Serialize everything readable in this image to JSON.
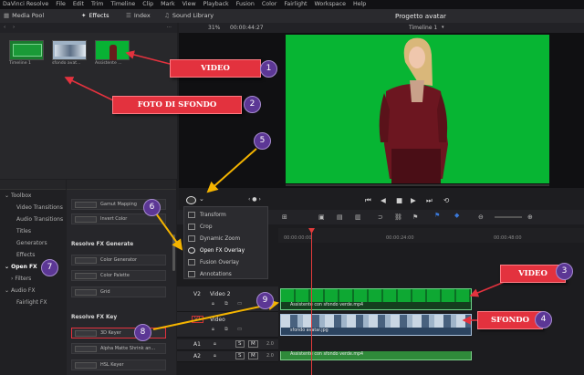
{
  "menu": [
    "DaVinci Resolve",
    "File",
    "Edit",
    "Trim",
    "Timeline",
    "Clip",
    "Mark",
    "View",
    "Playback",
    "Fusion",
    "Color",
    "Fairlight",
    "Workspace",
    "Help"
  ],
  "toolbar": {
    "media_pool": "Media Pool",
    "effects": "Effects",
    "index": "Index",
    "sound_library": "Sound Library",
    "project_title": "Progetto avatar"
  },
  "viewer": {
    "zoom": "31%",
    "timecode": "00:00:44:27",
    "timeline_name": "Timeline 1"
  },
  "media_pool": {
    "clips": [
      "Timeline 1",
      "sfondo avat...",
      "Assistente ..."
    ]
  },
  "sidebar": {
    "items": [
      "Toolbox",
      "Video Transitions",
      "Audio Transitions",
      "Titles",
      "Generators",
      "Effects",
      "Open FX",
      "Filters",
      "Audio FX",
      "Fairlight FX"
    ]
  },
  "fx_panel": {
    "items_top": [
      "Gamut Mapping",
      "Invert Color"
    ],
    "header_generate": "Resolve FX Generate",
    "items_generate": [
      "Color Generator",
      "Color Palette",
      "Grid"
    ],
    "header_key": "Resolve FX Key",
    "items_key": [
      "3D Keyer",
      "Alpha Matte Shrink an...",
      "HSL Keyer"
    ]
  },
  "dropdown": {
    "items": [
      "Transform",
      "Crop",
      "Dynamic Zoom",
      "Open FX Overlay",
      "Fusion Overlay",
      "Annotations"
    ]
  },
  "timeline": {
    "ruler": [
      "00:00:00:00",
      "00:00:24:00",
      "00:00:48:00"
    ],
    "tracks": {
      "v2_id": "V2",
      "v2_name": "Video 2",
      "v1_id": "V1",
      "v1_name": "Video",
      "a1_id": "A1",
      "a2_id": "A2",
      "a_level": "2.0"
    },
    "clips": {
      "v2": "Assistente con sfondo verde.mp4",
      "v1": "sfondo avatar.jpg",
      "a2": "Assistente con sfondo verde.mp4"
    }
  },
  "callouts": {
    "video_top": "VIDEO",
    "foto": "FOTO DI SFONDO",
    "video_tl": "VIDEO",
    "sfondo": "SFONDO"
  },
  "badges": [
    "1",
    "2",
    "3",
    "4",
    "5",
    "6",
    "7",
    "8",
    "9"
  ],
  "colors": {
    "callout": "#e3323e",
    "badge": "#5c3795",
    "chroma_green": "#07b533",
    "arrow": "#f4b400"
  }
}
